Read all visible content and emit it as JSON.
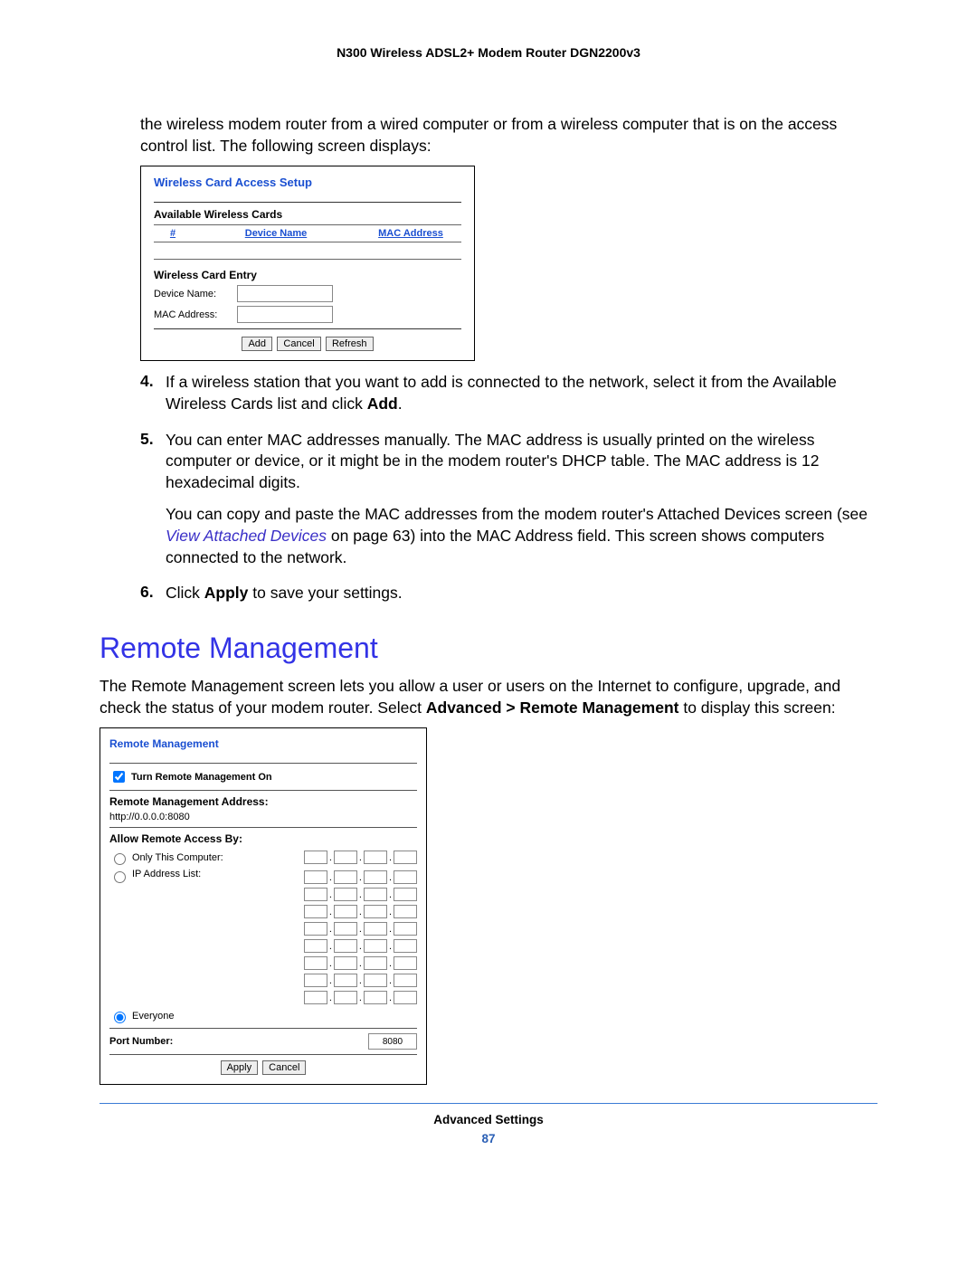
{
  "header": {
    "title": "N300 Wireless ADSL2+ Modem Router DGN2200v3"
  },
  "intro": "the wireless modem router from a wired computer or from a wireless computer that is on the access control list. The following screen displays:",
  "wcas": {
    "title": "Wireless Card Access Setup",
    "available_heading": "Available Wireless Cards",
    "col_num": "#",
    "col_device": "Device Name",
    "col_mac": "MAC Address",
    "entry_heading": "Wireless Card Entry",
    "device_label": "Device Name:",
    "mac_label": "MAC Address:",
    "btn_add": "Add",
    "btn_cancel": "Cancel",
    "btn_refresh": "Refresh"
  },
  "steps": {
    "4": {
      "num": "4.",
      "text_a": "If a wireless station that you want to add is connected to the network, select it from the Available Wireless Cards list and click ",
      "text_b": "Add",
      "text_c": "."
    },
    "5": {
      "num": "5.",
      "p1": "You can enter MAC addresses manually. The MAC address is usually printed on the wireless computer or device, or it might be in the modem router's DHCP table. The MAC address is 12 hexadecimal digits.",
      "p2a": "You can copy and paste the MAC addresses from the modem router's Attached Devices screen (see ",
      "p2link": "View Attached Devices ",
      "p2b": "on page 63) into the MAC Address field. This screen shows computers connected to the network."
    },
    "6": {
      "num": "6.",
      "a": "Click ",
      "b": "Apply",
      "c": " to save your settings."
    }
  },
  "section": {
    "title": "Remote Management",
    "para_a": "The Remote Management screen lets you allow a user or users on the Internet to configure, upgrade, and check the status of your modem router. Select ",
    "para_b": "Advanced > Remote Management",
    "para_c": " to display this screen:"
  },
  "rm": {
    "title": "Remote Management",
    "turn_on": "Turn Remote Management On",
    "addr_label": "Remote Management Address:",
    "addr_value": "http://0.0.0.0:8080",
    "allow_heading": "Allow Remote Access By:",
    "only_this": "Only This Computer:",
    "ip_list": "IP Address List:",
    "everyone": "Everyone",
    "port_label": "Port Number:",
    "port_value": "8080",
    "btn_apply": "Apply",
    "btn_cancel": "Cancel"
  },
  "footer": {
    "section": "Advanced Settings",
    "page": "87"
  }
}
